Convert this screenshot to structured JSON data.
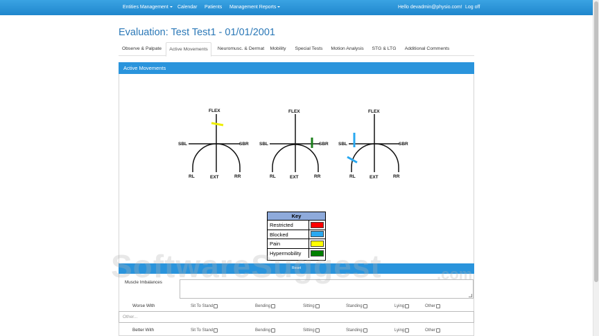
{
  "navbar": {
    "items": [
      "Entities Management",
      "Calendar",
      "Patients",
      "Management Reports"
    ],
    "user_greeting": "Hello devadmin@physio.com!",
    "logout": "Log off"
  },
  "page_title": "Evaluation: Test Test1 - 01/01/2001",
  "tabs": [
    "Observe & Palpate",
    "Active Movements",
    "Neuromusc. & Dermat",
    "Mobility",
    "Special Tests",
    "Motion Analysis",
    "STG & LTG",
    "Additional Comments"
  ],
  "active_tab": "Active Movements",
  "panel_title": "Active Movements",
  "diagram_labels": {
    "flex": "FLEX",
    "sbl": "SBL",
    "sbr": "SBR",
    "rl": "RL",
    "ext": "EXT",
    "rr": "RR"
  },
  "key": {
    "title": "Key",
    "rows": [
      {
        "label": "Restricted",
        "color": "#ff0000"
      },
      {
        "label": "Blocked",
        "color": "#29a8f0"
      },
      {
        "label": "Pain",
        "color": "#ffff00"
      },
      {
        "label": "Hypermobility",
        "color": "#008000"
      }
    ]
  },
  "reset_label": "Reset",
  "form": {
    "muscle_imbalances_label": "Muscle Imbalances",
    "worse_with_label": "Worse With",
    "better_with_label": "Better With",
    "options": [
      "Sit To Stand",
      "Bending",
      "Sitting",
      "Standing",
      "Lying",
      "Other"
    ],
    "other_placeholder": "Other..."
  },
  "watermark": {
    "main": "SoftwareSuggest",
    "suffix": ".com"
  },
  "colors": {
    "nav": "#2a92d8",
    "accent": "#2a94dc",
    "title": "#2b78b7"
  }
}
